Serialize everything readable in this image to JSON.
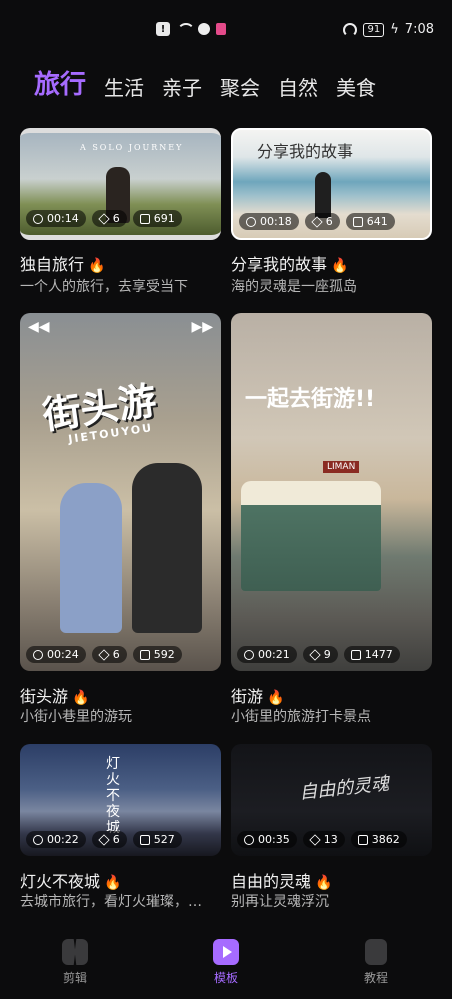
{
  "status": {
    "time": "7:08",
    "battery": "91"
  },
  "tabs": [
    {
      "label": "旅行",
      "active": true
    },
    {
      "label": "生活"
    },
    {
      "label": "亲子"
    },
    {
      "label": "聚会"
    },
    {
      "label": "自然"
    },
    {
      "label": "美食"
    }
  ],
  "cards": [
    {
      "title": "独自旅行",
      "subtitle": "一个人的旅行，去享受当下",
      "duration": "00:14",
      "layers": "6",
      "uses": "691",
      "overlay": "A SOLO JOURNEY"
    },
    {
      "title": "分享我的故事",
      "subtitle": "海的灵魂是一座孤岛",
      "duration": "00:18",
      "layers": "6",
      "uses": "641",
      "overlay": "分享我的故事"
    },
    {
      "title": "街头游",
      "subtitle": "小街小巷里的游玩",
      "duration": "00:24",
      "layers": "6",
      "uses": "592",
      "overlay": "街头游",
      "overlay_sub": "JIETOUYOU"
    },
    {
      "title": "街游",
      "subtitle": "小街里的旅游打卡景点",
      "duration": "00:21",
      "layers": "9",
      "uses": "1477",
      "overlay": "一起去街游!!",
      "sign": "LIMAN"
    },
    {
      "title": "灯火不夜城",
      "subtitle": "去城市旅行，看灯火璀璨，…",
      "duration": "00:22",
      "layers": "6",
      "uses": "527",
      "overlay": "灯火不夜城"
    },
    {
      "title": "自由的灵魂",
      "subtitle": "别再让灵魂浮沉",
      "duration": "00:35",
      "layers": "13",
      "uses": "3862",
      "overlay": "自由的灵魂"
    }
  ],
  "nav": [
    {
      "label": "剪辑"
    },
    {
      "label": "模板",
      "active": true
    },
    {
      "label": "教程"
    }
  ],
  "colors": {
    "accent": "#a66bff",
    "fire": "#ff9a2e"
  }
}
